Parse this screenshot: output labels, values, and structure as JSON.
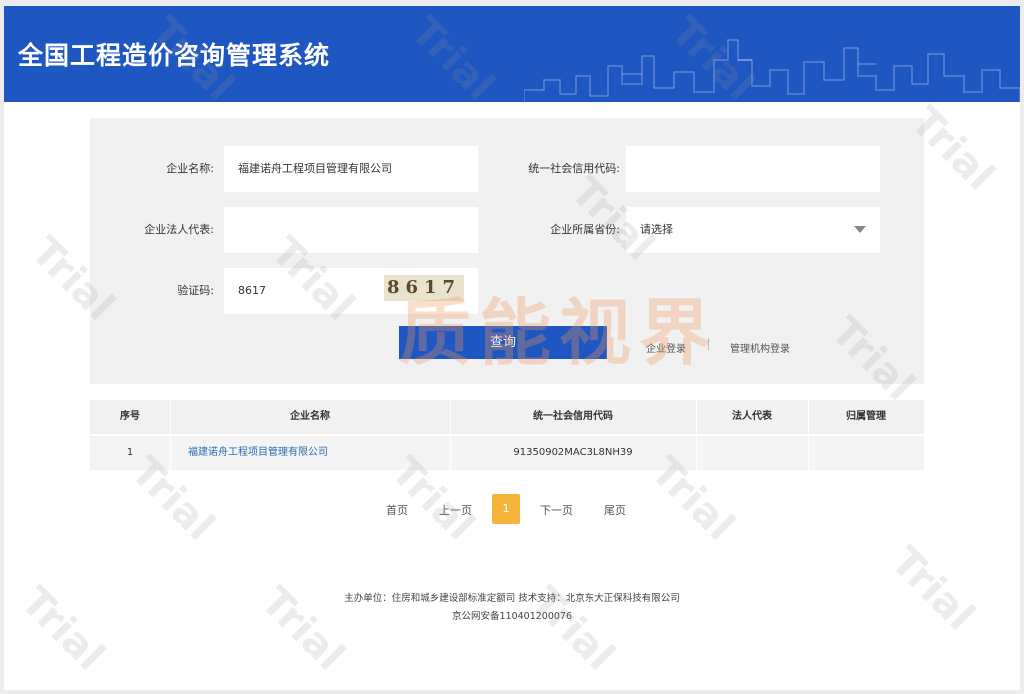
{
  "header": {
    "title": "全国工程造价咨询管理系统"
  },
  "search": {
    "company_name_label": "企业名称:",
    "company_name_value": "福建诺舟工程项目管理有限公司",
    "credit_code_label": "统一社会信用代码:",
    "credit_code_value": "",
    "legal_rep_label": "企业法人代表:",
    "legal_rep_value": "",
    "province_label": "企业所属省份:",
    "province_value": "请选择",
    "captcha_label": "验证码:",
    "captcha_input_value": "8617",
    "captcha_image_text": "8617",
    "query_button": "查询",
    "enterprise_login": "企业登录",
    "admin_login": "管理机构登录"
  },
  "table": {
    "columns": [
      "序号",
      "企业名称",
      "统一社会信用代码",
      "法人代表",
      "归属管理"
    ],
    "rows": [
      {
        "index": "1",
        "company": "福建诺舟工程项目管理有限公司",
        "credit_code": "91350902MAC3L8NH39",
        "legal_rep": "",
        "management": ""
      }
    ]
  },
  "pagination": {
    "first": "首页",
    "prev": "上一页",
    "current": "1",
    "next": "下一页",
    "last": "尾页"
  },
  "footer": {
    "line1": "主办单位：住房和城乡建设部标准定额司 技术支持：北京东大正保科技有限公司",
    "line2": "京公网安备110401200076"
  },
  "watermark": {
    "center_text": "质能视界",
    "trial_text": "Trial"
  },
  "colors": {
    "header_blue": "#1e56c2",
    "panel_gray": "#f1f1f1",
    "page_active": "#f5b53c",
    "link_blue": "#2b6cb0"
  }
}
